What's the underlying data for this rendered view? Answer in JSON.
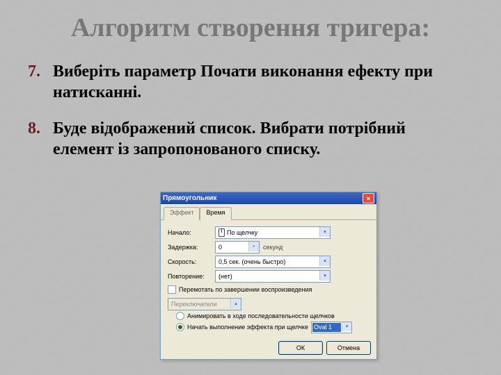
{
  "title": "Алгоритм створення тригера:",
  "items": {
    "seven": {
      "num": "7.",
      "text": "Виберіть параметр Почати виконання ефекту при натисканні."
    },
    "eight": {
      "num": "8.",
      "text": "Буде відображений список. Вибрати потрібний елемент із запропонованого списку."
    }
  },
  "dialog": {
    "title": "Прямоугольник",
    "close": "×",
    "tabs": {
      "effect": "Эффект",
      "time": "Время"
    },
    "labels": {
      "start": "Начало:",
      "delay": "Задержка:",
      "speed": "Скорость:",
      "repeat": "Повторение:"
    },
    "values": {
      "start": "По щелчку",
      "delay": "0",
      "delay_unit": "секунд",
      "speed": "0,5 сек. (очень быстро)",
      "repeat": "(нет)"
    },
    "check_rewind": "Перемотать по завершении воспроизведения",
    "triggers_btn": "Переключатели",
    "radio_seq": "Анимировать в ходе последовательности щелчков",
    "radio_click": "Начать выполнение эффекта при щелчке",
    "click_target": "Oval 1",
    "ok": "ОК",
    "cancel": "Отмена"
  }
}
